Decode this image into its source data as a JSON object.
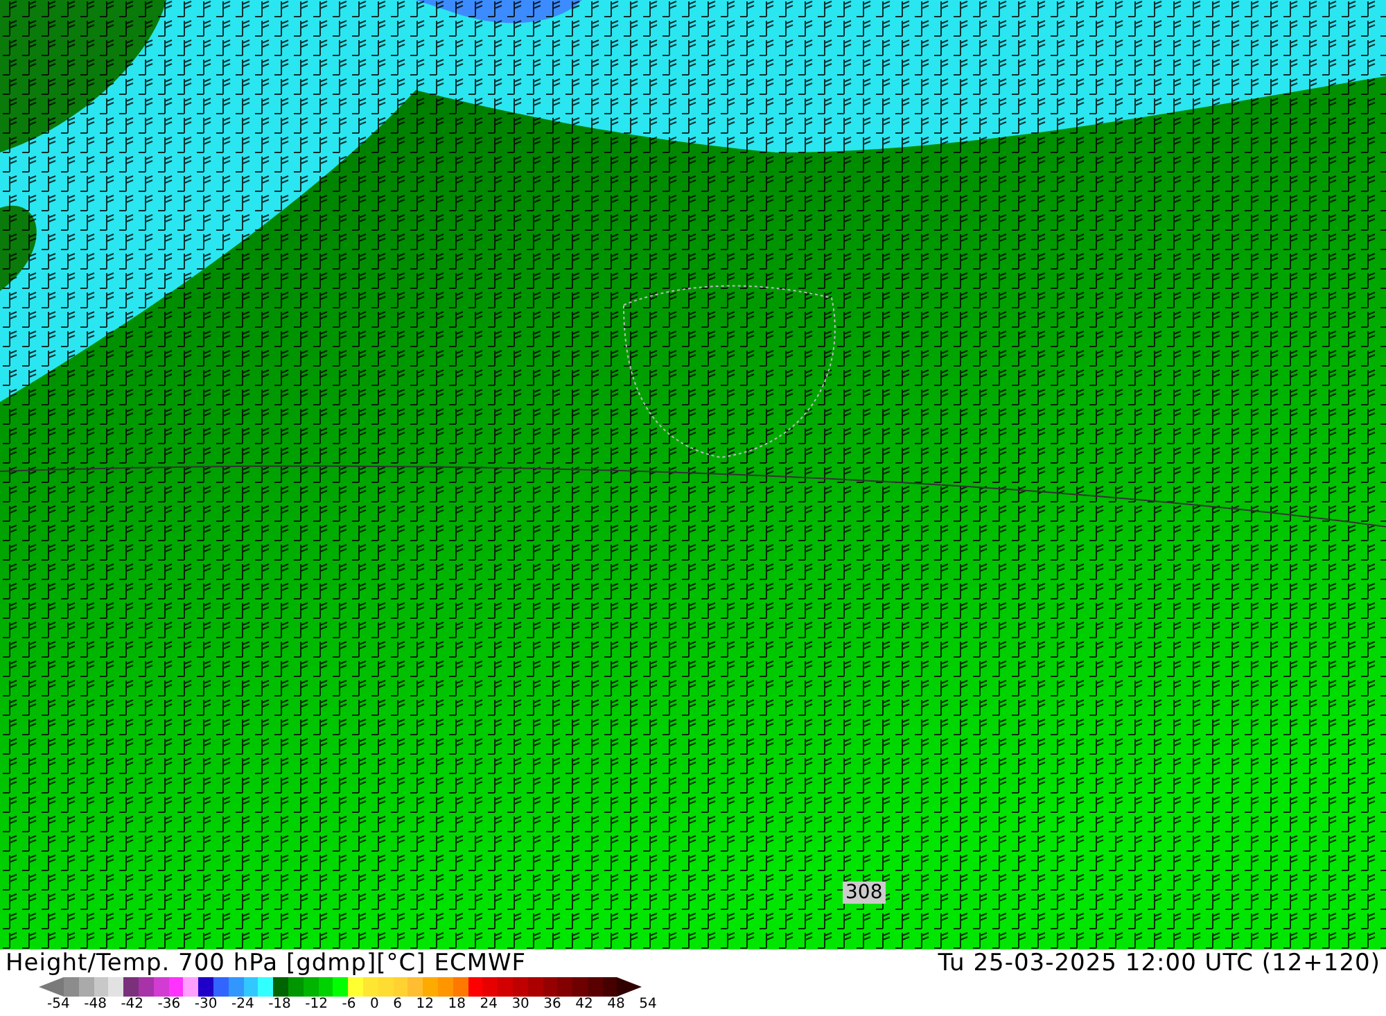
{
  "map": {
    "contour_label": "308"
  },
  "footer": {
    "title": "Height/Temp. 700 hPa [gdmp][°C] ECMWF",
    "valid_time": "Tu 25-03-2025 12:00 UTC (12+120)"
  },
  "colorbar": {
    "swatches": [
      {
        "kind": "under",
        "color": "#7a7a7a"
      },
      {
        "color": "#8c8c8c"
      },
      {
        "color": "#aaaaaa"
      },
      {
        "color": "#c8c8c8"
      },
      {
        "color": "#e2e2e2"
      },
      {
        "color": "#7a307a"
      },
      {
        "color": "#a832a8"
      },
      {
        "color": "#d23cd2"
      },
      {
        "color": "#ff32ff"
      },
      {
        "color": "#ffa0ff"
      },
      {
        "color": "#1e00c8"
      },
      {
        "color": "#3264ff"
      },
      {
        "color": "#3296ff"
      },
      {
        "color": "#32c8ff"
      },
      {
        "color": "#32ffff"
      },
      {
        "color": "#006400"
      },
      {
        "color": "#009600"
      },
      {
        "color": "#00b400"
      },
      {
        "color": "#00d200"
      },
      {
        "color": "#00ff00"
      },
      {
        "color": "#ffff32"
      },
      {
        "color": "#ffe632"
      },
      {
        "color": "#ffdc32"
      },
      {
        "color": "#ffd232"
      },
      {
        "color": "#ffbe32"
      },
      {
        "color": "#ffaa00"
      },
      {
        "color": "#ff9600"
      },
      {
        "color": "#ff7800"
      },
      {
        "color": "#ff0000"
      },
      {
        "color": "#e60000"
      },
      {
        "color": "#d20000"
      },
      {
        "color": "#be0000"
      },
      {
        "color": "#aa0000"
      },
      {
        "color": "#960000"
      },
      {
        "color": "#820000"
      },
      {
        "color": "#6e0000"
      },
      {
        "color": "#5a0000"
      },
      {
        "color": "#460000"
      },
      {
        "kind": "over",
        "color": "#300000"
      }
    ],
    "ticks": [
      "-54",
      "-48",
      "-42",
      "-36",
      "-30",
      "-24",
      "-18",
      "-12",
      "-6",
      "0",
      "6",
      "12",
      "18",
      "24",
      "30",
      "36",
      "42",
      "48",
      "54"
    ]
  }
}
